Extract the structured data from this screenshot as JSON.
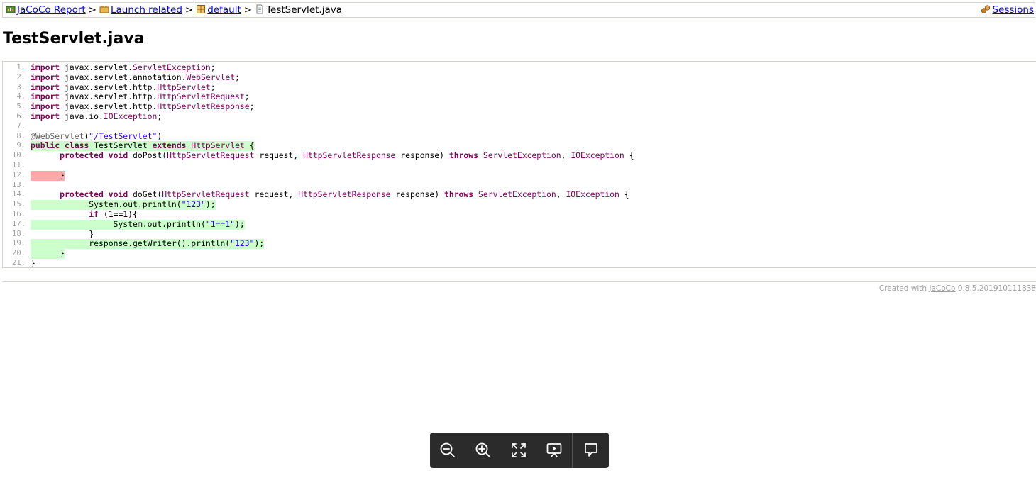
{
  "breadcrumb": {
    "items": [
      {
        "label": "JaCoCo Report",
        "link": true,
        "icon": "report-icon"
      },
      {
        "label": "Launch related",
        "link": true,
        "icon": "group-icon"
      },
      {
        "label": "default",
        "link": true,
        "icon": "package-icon"
      },
      {
        "label": "TestServlet.java",
        "link": false,
        "icon": "source-file-icon"
      }
    ],
    "separator": ">",
    "sessions_label": "Sessions",
    "sessions_icon": "session-icon"
  },
  "page": {
    "title": "TestServlet.java"
  },
  "source": {
    "lines": [
      {
        "num": "1.",
        "text": "import javax.servlet.ServletException;",
        "coverage": "none"
      },
      {
        "num": "2.",
        "text": "import javax.servlet.annotation.WebServlet;",
        "coverage": "none"
      },
      {
        "num": "3.",
        "text": "import javax.servlet.http.HttpServlet;",
        "coverage": "none"
      },
      {
        "num": "4.",
        "text": "import javax.servlet.http.HttpServletRequest;",
        "coverage": "none"
      },
      {
        "num": "5.",
        "text": "import javax.servlet.http.HttpServletResponse;",
        "coverage": "none"
      },
      {
        "num": "6.",
        "text": "import java.io.IOException;",
        "coverage": "none"
      },
      {
        "num": "7.",
        "text": "",
        "coverage": "none"
      },
      {
        "num": "8.",
        "text": "@WebServlet(\"/TestServlet\")",
        "coverage": "none"
      },
      {
        "num": "9.",
        "text": "public class TestServlet extends HttpServlet {",
        "coverage": "covered"
      },
      {
        "num": "10.",
        "text": "      protected void doPost(HttpServletRequest request, HttpServletResponse response) throws ServletException, IOException {",
        "coverage": "none"
      },
      {
        "num": "11.",
        "text": "",
        "coverage": "none"
      },
      {
        "num": "12.",
        "text": "      }",
        "coverage": "missed"
      },
      {
        "num": "13.",
        "text": "",
        "coverage": "none"
      },
      {
        "num": "14.",
        "text": "      protected void doGet(HttpServletRequest request, HttpServletResponse response) throws ServletException, IOException {",
        "coverage": "none"
      },
      {
        "num": "15.",
        "text": "            System.out.println(\"123\");",
        "coverage": "covered"
      },
      {
        "num": "16.",
        "text": "            if (1==1){",
        "coverage": "none"
      },
      {
        "num": "17.",
        "text": "                 System.out.println(\"1==1\");",
        "coverage": "covered"
      },
      {
        "num": "18.",
        "text": "            }",
        "coverage": "none"
      },
      {
        "num": "19.",
        "text": "            response.getWriter().println(\"123\");",
        "coverage": "covered"
      },
      {
        "num": "20.",
        "text": "      }",
        "coverage": "covered"
      },
      {
        "num": "21.",
        "text": "}",
        "coverage": "none"
      }
    ]
  },
  "footer": {
    "prefix": "Created with",
    "link_label": "JaCoCo",
    "version": "0.8.5.201910111838"
  },
  "viewer_toolbar": {
    "buttons": [
      {
        "name": "zoom-out-icon"
      },
      {
        "name": "zoom-in-icon"
      },
      {
        "name": "fit-screen-icon"
      },
      {
        "name": "slideshow-icon"
      },
      {
        "name": "comment-icon"
      }
    ]
  },
  "colors": {
    "covered": "#ccffcc",
    "missed": "#ffaaaa",
    "link": "#0000ee",
    "keyword": "#7f0055",
    "toolbar_bg": "#2b2b2b"
  }
}
